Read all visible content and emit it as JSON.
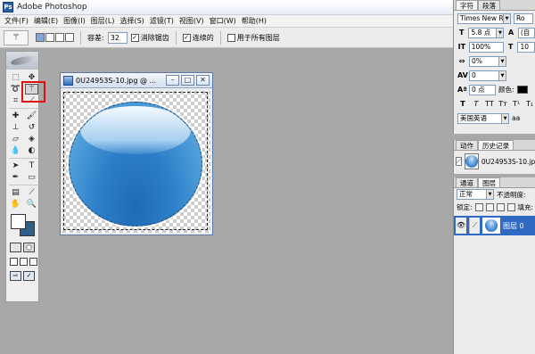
{
  "app": {
    "title": "Adobe Photoshop",
    "icon": "photoshop-app-icon"
  },
  "menu": [
    "文件(F)",
    "编辑(E)",
    "图像(I)",
    "图层(L)",
    "选择(S)",
    "滤镜(T)",
    "视图(V)",
    "窗口(W)",
    "帮助(H)"
  ],
  "options": {
    "tolerance_label": "容差:",
    "tolerance_value": "32",
    "antialias_label": "消除锯齿",
    "contiguous_label": "连续的",
    "all_layers_label": "用于所有图层"
  },
  "document": {
    "title": "0U24953S-10.jpg @ ..."
  },
  "character_panel": {
    "tabs": [
      "字符",
      "段落"
    ],
    "font_family": "Times New Ro...",
    "font_style": "Ro",
    "font_size": "5.8 点",
    "leading": "(自",
    "vertical_scale": "100%",
    "horizontal_scale": "10",
    "tracking": "0%",
    "kerning": "0",
    "baseline_shift": "0 点",
    "color_label": "颜色:",
    "language": "美国英语",
    "antialias_abbr": "aa"
  },
  "history_panel": {
    "tabs": [
      "动作",
      "历史记录"
    ],
    "snapshot_name": "0U24953S-10.jpg"
  },
  "layers_panel": {
    "tabs": [
      "通道",
      "图层"
    ],
    "blend_mode": "正常",
    "opacity_label": "不透明度:",
    "lock_label": "锁定:",
    "fill_label": "填充:",
    "layer_name": "图层 0"
  },
  "colors": {
    "foreground": "#ffffff",
    "background": "#2f5e88",
    "highlight_box": "#e01010",
    "layer_selected": "#316ac5"
  }
}
